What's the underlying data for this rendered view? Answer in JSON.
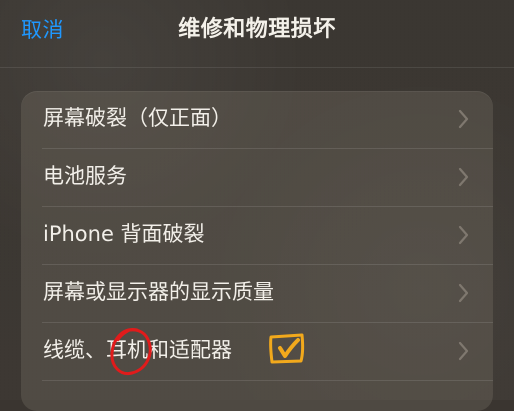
{
  "header": {
    "cancel_label": "取消",
    "title": "维修和物理损坏"
  },
  "menu": {
    "items": [
      {
        "label": "屏幕破裂（仅正面）"
      },
      {
        "label": "电池服务"
      },
      {
        "label": "iPhone 背面破裂"
      },
      {
        "label": "屏幕或显示器的显示质量"
      },
      {
        "label": "线缆、耳机和适配器"
      },
      {
        "label": ""
      }
    ]
  },
  "annotations": {
    "circle_color": "#e11b1b",
    "check_color": "#f2a91c"
  },
  "colors": {
    "accent": "#1f98ff",
    "background": "#3a3530",
    "card_background": "#7a7268",
    "text": "#f2efe9"
  }
}
